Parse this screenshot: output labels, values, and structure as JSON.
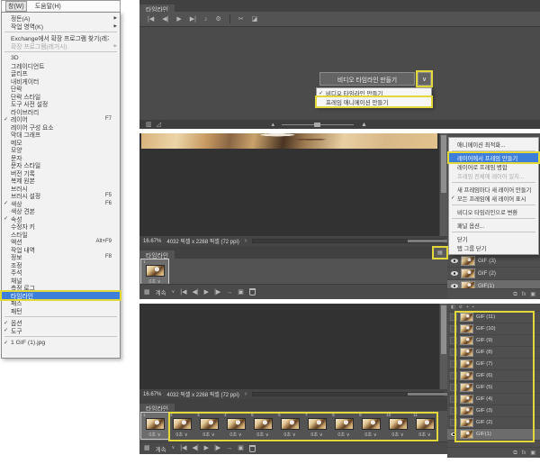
{
  "colors": {
    "accent_blue": "#3d7edb",
    "highlight_yellow": "#e3d839",
    "panel_gray": "#535353",
    "canvas_gray": "#323232"
  },
  "menubar": {
    "window": "창(W)",
    "help": "도움말(H)"
  },
  "window_menu": {
    "items": [
      {
        "label": "정돈(A)",
        "arrow": true
      },
      {
        "label": "작업 영역(K)",
        "arrow": true
      },
      {
        "sep": true
      },
      {
        "label": "Exchange에서 확장 프로그램 찾기(레거시)..."
      },
      {
        "label": "확장 프로그램(레거시)",
        "arrow": true,
        "disabled": true
      },
      {
        "sep": true
      },
      {
        "label": "3D"
      },
      {
        "label": "그레이디언트"
      },
      {
        "label": "글리프"
      },
      {
        "label": "내비게이터"
      },
      {
        "label": "단락"
      },
      {
        "label": "단락 스타일"
      },
      {
        "label": "도구 사전 설정"
      },
      {
        "label": "라이브러리"
      },
      {
        "label": "레이어",
        "checked": true,
        "shortcut": "F7"
      },
      {
        "label": "레이어 구성 요소"
      },
      {
        "label": "막대 그래프"
      },
      {
        "label": "메모"
      },
      {
        "label": "모양"
      },
      {
        "label": "문자"
      },
      {
        "label": "문자 스타일"
      },
      {
        "label": "버전 기록"
      },
      {
        "label": "복제 원본"
      },
      {
        "label": "브러시"
      },
      {
        "label": "브러시 설정",
        "shortcut": "F5"
      },
      {
        "label": "색상",
        "checked": true,
        "shortcut": "F6"
      },
      {
        "label": "색상 견본"
      },
      {
        "label": "속성",
        "checked": true
      },
      {
        "label": "수정자 키"
      },
      {
        "label": "스타일"
      },
      {
        "label": "액션",
        "shortcut": "Alt+F9"
      },
      {
        "label": "작업 내역"
      },
      {
        "label": "정보",
        "shortcut": "F8"
      },
      {
        "label": "조정"
      },
      {
        "label": "주석"
      },
      {
        "label": "채널"
      },
      {
        "label": "측정 로그"
      },
      {
        "label": "타임라인",
        "highlighted": true,
        "boxed": true
      },
      {
        "label": "패스"
      },
      {
        "label": "패턴"
      },
      {
        "sep": true
      },
      {
        "label": "옵션",
        "checked": true
      },
      {
        "label": "도구",
        "checked": true
      },
      {
        "sep": true
      },
      {
        "label": "1 GIF (1).jpg",
        "checked": true
      }
    ]
  },
  "timeline_tab": "타임라인",
  "top_panel": {
    "toolbar_left": [
      {
        "name": "first-frame",
        "glyph": "|◀"
      },
      {
        "name": "prev-frame",
        "glyph": "◀|"
      },
      {
        "name": "play",
        "glyph": "▶"
      },
      {
        "name": "next-frame",
        "glyph": "▶|"
      },
      {
        "name": "audio",
        "glyph": "♪"
      },
      {
        "name": "settings",
        "glyph": "⚙"
      }
    ],
    "toolbar_right": [
      {
        "name": "split-scissors",
        "glyph": "✂"
      },
      {
        "name": "transition",
        "glyph": "◪"
      }
    ],
    "create_button": "비디오 타임라인 만들기",
    "chevron_glyph": "∨",
    "dropdown": [
      {
        "label": "비디오 타임라인 만들기",
        "checked": true
      },
      {
        "label": "프레임 애니메이션 만들기",
        "boxed": true
      }
    ]
  },
  "status": {
    "zoom_level": "16.67%",
    "doc_size": "4032 픽셀 x 2268 픽셀 (72 ppi)",
    "chevron": "›"
  },
  "frame_controls": {
    "loop_label": "계속",
    "loop_chevron": "∨",
    "icons_left": [
      {
        "name": "convert-to-video",
        "glyph": "▦"
      }
    ],
    "icons_mid": [
      {
        "name": "first-frame",
        "glyph": "|◀"
      },
      {
        "name": "prev-frame",
        "glyph": "◀|"
      },
      {
        "name": "play",
        "glyph": "▶"
      },
      {
        "name": "next-frame",
        "glyph": "|▶"
      },
      {
        "name": "tween",
        "glyph": "→"
      },
      {
        "name": "new-frame",
        "glyph": "▣"
      }
    ]
  },
  "middle": {
    "frames": [
      {
        "num": "1",
        "duration": "0초 ∨",
        "selected": true
      }
    ],
    "layers": [
      {
        "name": "GIF (3)",
        "visible": true
      },
      {
        "name": "GIF (2)",
        "visible": true
      },
      {
        "name": "GIF(1)",
        "visible": true,
        "selected": true
      }
    ],
    "panel_menu_glyph": "▤",
    "layer_bottom_icons": [
      {
        "name": "link-layers",
        "glyph": "⧉"
      },
      {
        "name": "layer-effects",
        "glyph": "fx"
      },
      {
        "name": "layer-mask",
        "glyph": "▣"
      }
    ]
  },
  "context_menu": {
    "items": [
      {
        "label": "애니메이션 최적화..."
      },
      {
        "sep": true
      },
      {
        "label": "레이어에서 프레임 만들기",
        "highlighted": true,
        "boxed": true
      },
      {
        "label": "레이어로 프레임 병합"
      },
      {
        "label": "프레임 전체에 레이어 일치...",
        "disabled": true
      },
      {
        "sep": true
      },
      {
        "label": "새 프레임마다 새 레이어 만들기"
      },
      {
        "label": "모든 프레임에 새 레이어 표시",
        "checked": true
      },
      {
        "sep": true
      },
      {
        "label": "비디오 타임라인으로 변환"
      },
      {
        "sep": true
      },
      {
        "label": "패널 옵션..."
      },
      {
        "sep": true
      },
      {
        "label": "닫기"
      },
      {
        "label": "탭 그룹 닫기"
      }
    ]
  },
  "bottom": {
    "frames": [
      {
        "num": "1",
        "duration": "0초 ∨",
        "selected": true
      },
      {
        "num": "2",
        "duration": "0초 ∨"
      },
      {
        "num": "3",
        "duration": "0초 ∨"
      },
      {
        "num": "4",
        "duration": "0초 ∨"
      },
      {
        "num": "5",
        "duration": "0초 ∨"
      },
      {
        "num": "6",
        "duration": "0초 ∨"
      },
      {
        "num": "7",
        "duration": "0초 ∨"
      },
      {
        "num": "8",
        "duration": "0초 ∨"
      },
      {
        "num": "9",
        "duration": "0초 ∨"
      },
      {
        "num": "10",
        "duration": "0초 ∨"
      },
      {
        "num": "11",
        "duration": "0초 ∨"
      }
    ],
    "layers": [
      {
        "name": "GIF (11)"
      },
      {
        "name": "GIF (10)"
      },
      {
        "name": "GIF (9)"
      },
      {
        "name": "GIF (8)"
      },
      {
        "name": "GIF (7)"
      },
      {
        "name": "GIF (6)"
      },
      {
        "name": "GIF (5)"
      },
      {
        "name": "GIF (4)"
      },
      {
        "name": "GIF (3)"
      },
      {
        "name": "GIF (2)"
      },
      {
        "name": "GIF(1)",
        "visible": true,
        "selected": true
      }
    ],
    "lock_row_icons": [
      {
        "name": "lock-transparent",
        "glyph": "◧"
      },
      {
        "name": "lock-pixels",
        "glyph": "⊘"
      },
      {
        "name": "lock-position",
        "glyph": "+"
      },
      {
        "name": "lock-all",
        "glyph": "▪"
      }
    ]
  }
}
